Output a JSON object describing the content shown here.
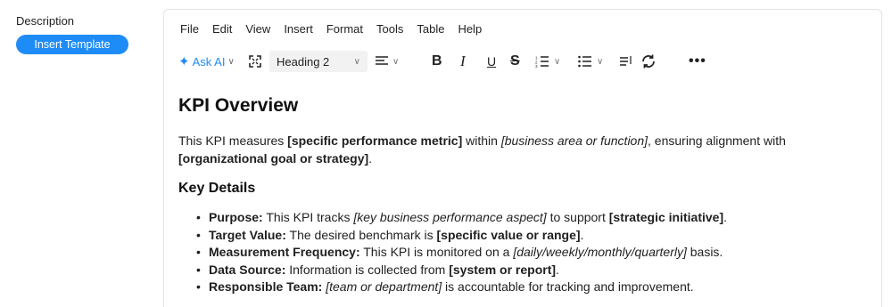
{
  "sidebar": {
    "label": "Description",
    "insert_template": "Insert Template"
  },
  "menu": [
    "File",
    "Edit",
    "View",
    "Insert",
    "Format",
    "Tools",
    "Table",
    "Help"
  ],
  "toolbar": {
    "ask_ai": "Ask AI",
    "block_format": "Heading 2"
  },
  "doc": {
    "title": "KPI Overview",
    "intro": {
      "t1": "This KPI measures ",
      "b1": "[specific performance metric]",
      "t2": " within ",
      "i1": "[business area or function]",
      "t3": ", ensuring alignment with ",
      "b2": "[organizational goal or strategy]",
      "t4": "."
    },
    "subheading": "Key Details",
    "items": [
      {
        "label": "Purpose:",
        "t1": " This KPI tracks ",
        "i1": "[key business performance aspect]",
        "t2": " to support ",
        "b1": "[strategic initiative]",
        "t3": "."
      },
      {
        "label": "Target Value:",
        "t1": " The desired benchmark is ",
        "b1": "[specific value or range]",
        "t2": "."
      },
      {
        "label": "Measurement Frequency:",
        "t1": " This KPI is monitored on a ",
        "i1": "[daily/weekly/monthly/quarterly]",
        "t2": " basis."
      },
      {
        "label": "Data Source:",
        "t1": " Information is collected from ",
        "b1": "[system or report]",
        "t2": "."
      },
      {
        "label": "Responsible Team:",
        "t1": " ",
        "i1": "[team or department]",
        "t2": " is accountable for tracking and improvement."
      }
    ]
  },
  "colors": {
    "accent": "#1e8cf7"
  }
}
